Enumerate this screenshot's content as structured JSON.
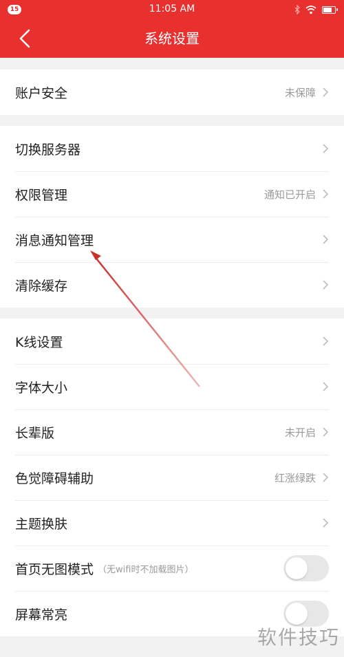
{
  "status": {
    "badge": "15",
    "time": "11:05 AM",
    "battery_level": 0.8
  },
  "header": {
    "title": "系统设置",
    "back_icon": "chevron-left-icon"
  },
  "groups": [
    {
      "items": [
        {
          "label": "账户安全",
          "value": "未保障"
        }
      ]
    },
    {
      "items": [
        {
          "label": "切换服务器",
          "value": ""
        },
        {
          "label": "权限管理",
          "value": "通知已开启"
        },
        {
          "label": "消息通知管理",
          "value": ""
        },
        {
          "label": "清除缓存",
          "value": ""
        }
      ]
    },
    {
      "items": [
        {
          "label": "K线设置",
          "value": ""
        },
        {
          "label": "字体大小",
          "value": ""
        },
        {
          "label": "长辈版",
          "value": "未开启"
        },
        {
          "label": "色觉障碍辅助",
          "value": "红涨绿跌"
        },
        {
          "label": "主题换肤",
          "value": ""
        },
        {
          "label": "首页无图模式",
          "hint": "（无wifi时不加载图片）",
          "toggle": false
        },
        {
          "label": "屏幕常亮",
          "toggle": false
        }
      ]
    }
  ],
  "watermark": "软件技巧",
  "colors": {
    "brand_red": "#e8302f",
    "annotation_arrow": "#c9302c"
  }
}
